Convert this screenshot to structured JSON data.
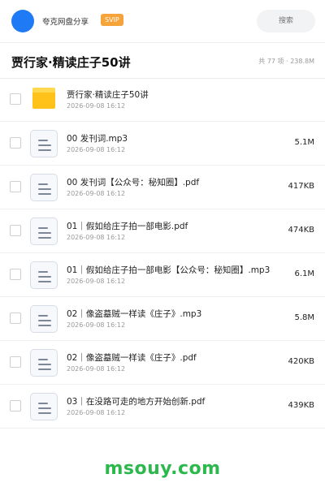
{
  "header": {
    "username": "夸克网盘分享",
    "badge": "SVIP",
    "search_placeholder": "搜索",
    "brand_color": "#1f7bf5",
    "badge_color": "#f6a33a"
  },
  "folder": {
    "title": "贾行家·精读庄子50讲",
    "stats": "共 77 项 · 238.8M"
  },
  "files": [
    {
      "name": "贾行家·精读庄子50讲",
      "date": "2026-09-08 16:12",
      "size": "",
      "icon": "folder-icon"
    },
    {
      "name": "00 发刊词.mp3",
      "date": "2026-09-08 16:12",
      "size": "5.1M",
      "icon": "file-icon"
    },
    {
      "name": "00 发刊词【公众号：秘知圈】.pdf",
      "date": "2026-09-08 16:12",
      "size": "417KB",
      "icon": "file-icon"
    },
    {
      "name": "01｜假如给庄子拍一部电影.pdf",
      "date": "2026-09-08 16:12",
      "size": "474KB",
      "icon": "file-icon"
    },
    {
      "name": "01｜假如给庄子拍一部电影【公众号：秘知圈】.mp3",
      "date": "2026-09-08 16:12",
      "size": "6.1M",
      "icon": "file-icon"
    },
    {
      "name": "02｜像盗墓贼一样读《庄子》.mp3",
      "date": "2026-09-08 16:12",
      "size": "5.8M",
      "icon": "file-icon"
    },
    {
      "name": "02｜像盗墓贼一样读《庄子》.pdf",
      "date": "2026-09-08 16:12",
      "size": "420KB",
      "icon": "file-icon"
    },
    {
      "name": "03｜在没路可走的地方开始创新.pdf",
      "date": "2026-09-08 16:12",
      "size": "439KB",
      "icon": "file-icon"
    }
  ],
  "watermark": {
    "text": "msouy.com",
    "color": "#2db84d"
  }
}
